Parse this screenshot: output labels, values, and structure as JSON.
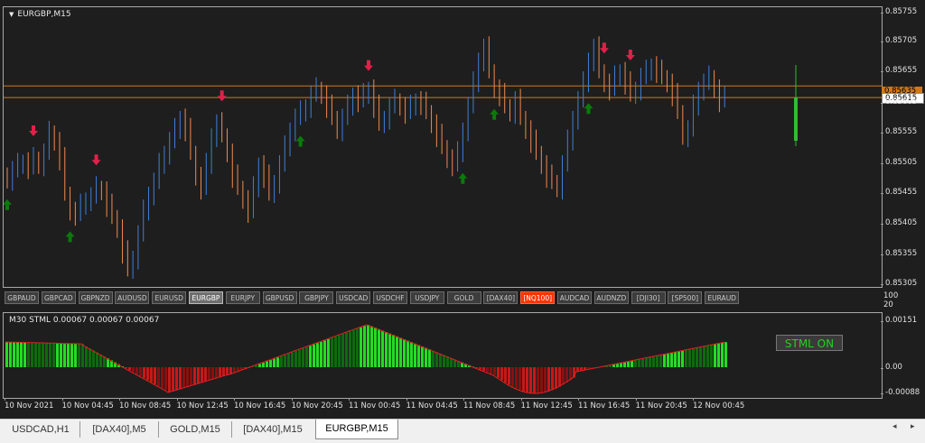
{
  "chart": {
    "title": "EURGBP,M15",
    "price_ticks": [
      "0.85755",
      "0.85705",
      "0.85655",
      "0.85605",
      "0.85555",
      "0.85505",
      "0.85455",
      "0.85405",
      "0.85355",
      "0.85305"
    ],
    "bid_label": "0.85635",
    "ask_label": "0.85615",
    "colors": {
      "bull": "#3f7fd8",
      "bear": "#f08a50",
      "up_arrow": "#0b7a0b",
      "down_arrow": "#e0204a",
      "price_line": "#d07818",
      "live_bar": "#33bb33"
    }
  },
  "symbol_buttons": [
    {
      "label": "GBPAUD",
      "state": "normal"
    },
    {
      "label": "GBPCAD",
      "state": "normal"
    },
    {
      "label": "GBPNZD",
      "state": "normal"
    },
    {
      "label": "AUDUSD",
      "state": "normal"
    },
    {
      "label": "EURUSD",
      "state": "normal"
    },
    {
      "label": "EURGBP",
      "state": "selected"
    },
    {
      "label": "EURJPY",
      "state": "normal"
    },
    {
      "label": "GBPUSD",
      "state": "normal"
    },
    {
      "label": "GBPJPY",
      "state": "normal"
    },
    {
      "label": "USDCAD",
      "state": "normal"
    },
    {
      "label": "USDCHF",
      "state": "normal"
    },
    {
      "label": "USDJPY",
      "state": "normal"
    },
    {
      "label": "GOLD",
      "state": "normal"
    },
    {
      "label": "[DAX40]",
      "state": "normal"
    },
    {
      "label": "[NQ100]",
      "state": "hot"
    },
    {
      "label": "AUDCAD",
      "state": "normal"
    },
    {
      "label": "AUDNZD",
      "state": "normal"
    },
    {
      "label": "[DJI30]",
      "state": "normal"
    },
    {
      "label": "[SP500]",
      "state": "normal"
    },
    {
      "label": "EURAUD",
      "state": "normal"
    }
  ],
  "strip_scale": [
    "100",
    "20"
  ],
  "indicator": {
    "title": "M30 STML 0.00067 0.00067 0.00067",
    "ticks": [
      "0.00151",
      "0.00",
      "-0.00088"
    ],
    "button_label": "STML ON",
    "colors": {
      "bright": "#22dd22",
      "dark": "#0d6b0d",
      "red": "#c81818",
      "dark_red": "#8a1010",
      "line": "#e02020"
    }
  },
  "time_ticks": [
    "10 Nov 2021",
    "10 Nov 04:45",
    "10 Nov 08:45",
    "10 Nov 12:45",
    "10 Nov 16:45",
    "10 Nov 20:45",
    "11 Nov 00:45",
    "11 Nov 04:45",
    "11 Nov 08:45",
    "11 Nov 12:45",
    "11 Nov 16:45",
    "11 Nov 20:45",
    "12 Nov 00:45"
  ],
  "tabs": [
    {
      "label": "USDCAD,H1",
      "active": false
    },
    {
      "label": "[DAX40],M5",
      "active": false
    },
    {
      "label": "GOLD,M15",
      "active": false
    },
    {
      "label": "[DAX40],M15",
      "active": false
    },
    {
      "label": "EURGBP,M15",
      "active": true
    }
  ],
  "chart_data": {
    "type": "candlestick",
    "title": "EURGBP,M15",
    "ylim": [
      0.8529,
      0.8577
    ],
    "bid": 0.85635,
    "ask": 0.85615,
    "closes": [
      0.85475,
      0.8549,
      0.855,
      0.85505,
      0.85495,
      0.8551,
      0.855,
      0.8552,
      0.85555,
      0.8554,
      0.8551,
      0.8545,
      0.8542,
      0.85415,
      0.8543,
      0.8544,
      0.85445,
      0.8546,
      0.85455,
      0.8543,
      0.8541,
      0.8539,
      0.8535,
      0.8532,
      0.8534,
      0.8538,
      0.8542,
      0.8545,
      0.8547,
      0.855,
      0.8552,
      0.8554,
      0.8556,
      0.8558,
      0.8556,
      0.8552,
      0.8548,
      0.8546,
      0.855,
      0.8555,
      0.8557,
      0.8555,
      0.8552,
      0.8548,
      0.8546,
      0.8544,
      0.8542,
      0.8546,
      0.855,
      0.8548,
      0.8545,
      0.8547,
      0.855,
      0.8553,
      0.8556,
      0.8558,
      0.8559,
      0.856,
      0.8562,
      0.8563,
      0.8562,
      0.856,
      0.8558,
      0.8556,
      0.8558,
      0.856,
      0.8562,
      0.8561,
      0.8562,
      0.8563,
      0.856,
      0.8557,
      0.8558,
      0.856,
      0.8561,
      0.856,
      0.8559,
      0.856,
      0.8561,
      0.85605,
      0.8559,
      0.8557,
      0.8555,
      0.8553,
      0.8551,
      0.855,
      0.8552,
      0.8556,
      0.856,
      0.8564,
      0.8568,
      0.857,
      0.8566,
      0.8563,
      0.8562,
      0.856,
      0.8559,
      0.8561,
      0.8558,
      0.8556,
      0.8554,
      0.8552,
      0.855,
      0.8548,
      0.8547,
      0.8546,
      0.855,
      0.8554,
      0.8558,
      0.8561,
      0.8564,
      0.8568,
      0.857,
      0.8566,
      0.8564,
      0.8563,
      0.8565,
      0.8566,
      0.8564,
      0.8562,
      0.8563,
      0.8565,
      0.8566,
      0.8567,
      0.8566,
      0.8565,
      0.8564,
      0.8562,
      0.8559,
      0.8555,
      0.8556,
      0.856,
      0.8563,
      0.8564,
      0.8565,
      0.8563,
      0.8561,
      0.85615
    ],
    "up_signals_at": [
      0,
      12,
      56,
      87,
      93,
      111
    ],
    "down_signals_at": [
      5,
      17,
      41,
      69,
      114,
      119
    ]
  }
}
